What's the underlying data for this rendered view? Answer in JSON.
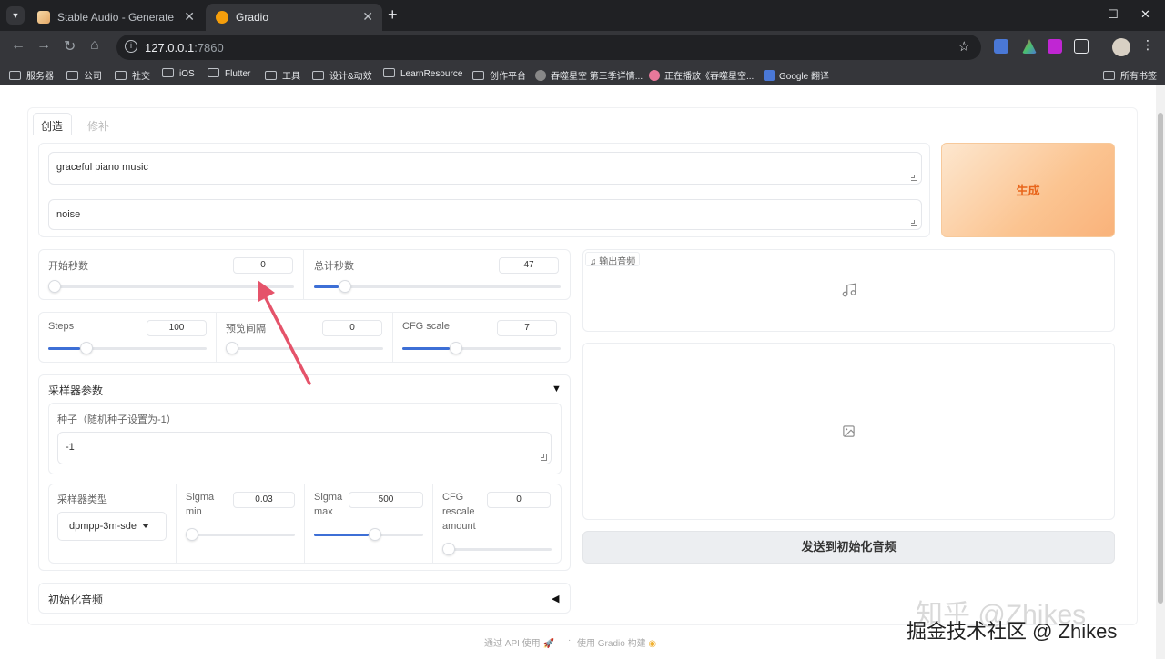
{
  "browser": {
    "tabs": [
      {
        "title": "Stable Audio - Generate",
        "active": false
      },
      {
        "title": "Gradio",
        "active": true
      }
    ],
    "url_host": "127.0.0.1",
    "url_port": ":7860",
    "bookmarks": [
      "服务器",
      "公司",
      "社交",
      "iOS",
      "Flutter",
      "工具",
      "设计&动效",
      "LearnResource",
      "创作平台",
      "吞噬星空 第三季详情...",
      "正在播放《吞噬星空...",
      "Google 翻译"
    ],
    "bookmarks_all": "所有书签"
  },
  "mode_tabs": {
    "create": "创造",
    "inpaint": "修补"
  },
  "prompt": {
    "value": "graceful piano music"
  },
  "negative_prompt": {
    "value": "noise"
  },
  "generate_label": "生成",
  "start_seconds": {
    "label": "开始秒数",
    "value": "0",
    "fraction": 0.0
  },
  "total_seconds": {
    "label": "总计秒数",
    "value": "47",
    "fraction": 0.1
  },
  "steps": {
    "label": "Steps",
    "value": "100",
    "fraction": 0.2
  },
  "preview_interval": {
    "label": "预览间隔",
    "value": "0",
    "fraction": 0.0
  },
  "cfg_scale": {
    "label": "CFG scale",
    "value": "7",
    "fraction": 0.3
  },
  "sampler_params": {
    "title": "采样器参数",
    "seed": {
      "label": "种子（随机种子设置为-1）",
      "value": "-1"
    },
    "sampler_type": {
      "label": "采样器类型",
      "value": "dpmpp-3m-sde"
    },
    "sigma_min": {
      "label_1": "Sigma",
      "label_2": "min",
      "value": "0.03",
      "fraction": 0.0
    },
    "sigma_max": {
      "label_1": "Sigma",
      "label_2": "max",
      "value": "500",
      "fraction": 0.5
    },
    "cfg_rescale": {
      "label_1": "CFG",
      "label_2": "rescale",
      "label_3": "amount",
      "value": "0",
      "fraction": 0.0
    }
  },
  "init_audio": {
    "title": "初始化音频"
  },
  "output_audio_label": "输出音频",
  "send_to_init_label": "发送到初始化音频",
  "footer": {
    "api": "通过 API 使用",
    "sep": "·",
    "built": "使用 Gradio 构建"
  },
  "watermark": {
    "primary": "掘金技术社区 @ Zhikes",
    "ghost": "知乎 @Zhikes"
  },
  "colors": {
    "accent": "#3d6fd6",
    "generate": "#e8651b",
    "annotation_arrow": "#e5536a"
  }
}
